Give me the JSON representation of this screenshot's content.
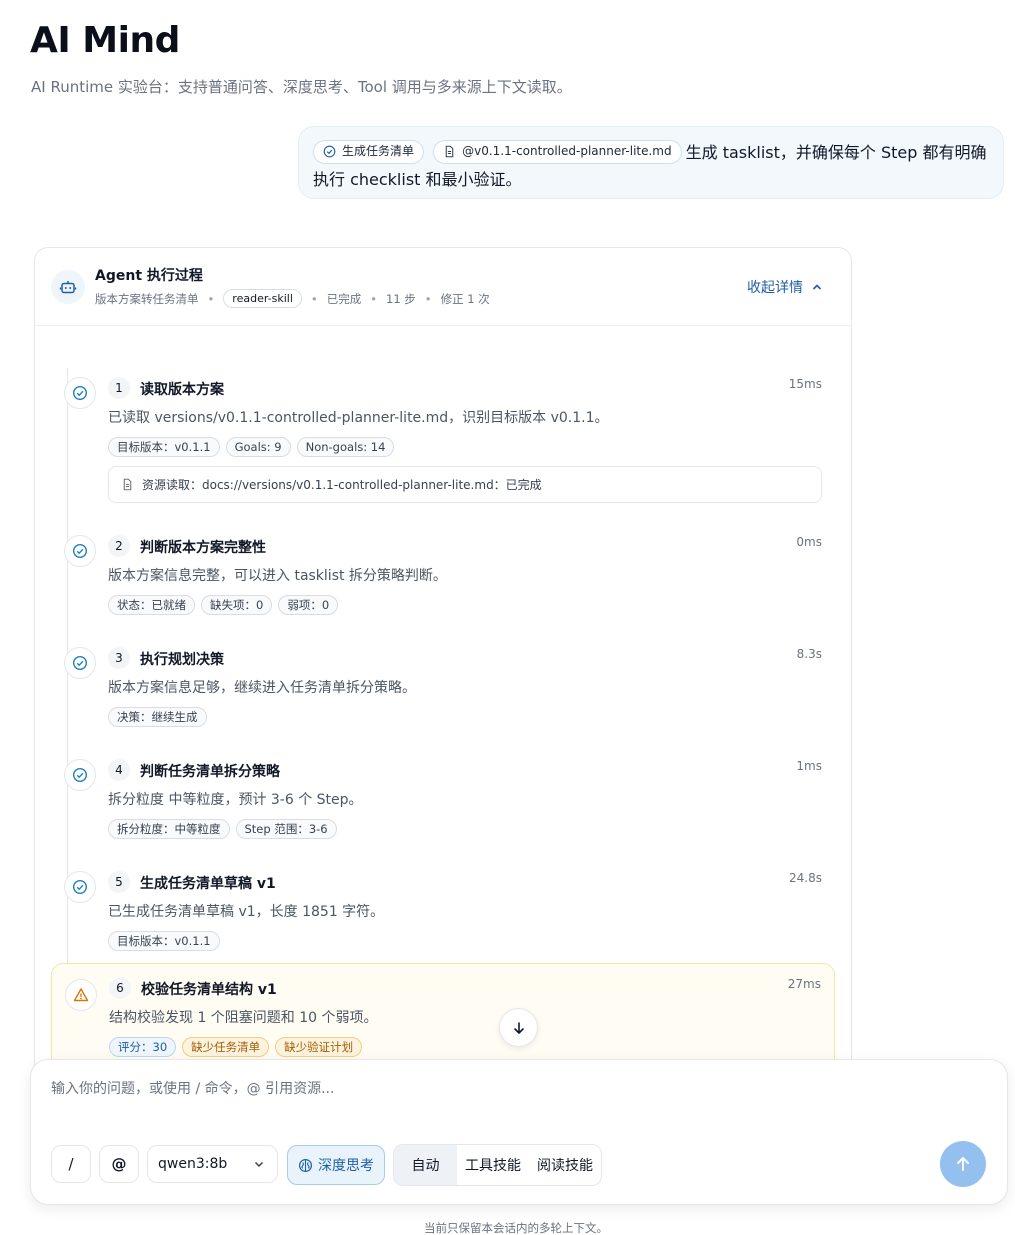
{
  "app": {
    "title": "AI Mind",
    "subtitle": "AI Runtime 实验台：支持普通问答、深度思考、Tool 调用与多来源上下文读取。"
  },
  "user_message": {
    "skill_chip": "生成任务清单",
    "file_chip": "@v0.1.1-controlled-planner-lite.md",
    "text": "生成 tasklist，并确保每个 Step 都有明确执行 checklist 和最小验证。"
  },
  "agent_panel": {
    "title": "Agent 执行过程",
    "meta": {
      "mode": "版本方案转任务清单",
      "skill": "reader-skill",
      "status": "已完成",
      "steps": "11 步",
      "revisions": "修正 1 次"
    },
    "collapse_label": "收起详情",
    "steps": [
      {
        "num": "1",
        "title": "读取版本方案",
        "time": "15ms",
        "desc": "已读取 versions/v0.1.1-controlled-planner-lite.md，识别目标版本 v0.1.1。",
        "tags": [
          "目标版本：v0.1.1",
          "Goals: 9",
          "Non-goals: 14"
        ],
        "resource": "资源读取：docs://versions/v0.1.1-controlled-planner-lite.md：已完成"
      },
      {
        "num": "2",
        "title": "判断版本方案完整性",
        "time": "0ms",
        "desc": "版本方案信息完整，可以进入 tasklist 拆分策略判断。",
        "tags": [
          "状态：已就绪",
          "缺失项：0",
          "弱项：0"
        ]
      },
      {
        "num": "3",
        "title": "执行规划决策",
        "time": "8.3s",
        "desc": "版本方案信息足够，继续进入任务清单拆分策略。",
        "tags": [
          "决策：继续生成"
        ]
      },
      {
        "num": "4",
        "title": "判断任务清单拆分策略",
        "time": "1ms",
        "desc": "拆分粒度 中等粒度，预计 3-6 个 Step。",
        "tags": [
          "拆分粒度：中等粒度",
          "Step 范围：3-6"
        ]
      },
      {
        "num": "5",
        "title": "生成任务清单草稿 v1",
        "time": "24.8s",
        "desc": "已生成任务清单草稿 v1，长度 1851 字符。",
        "tags": [
          "目标版本：v0.1.1"
        ]
      },
      {
        "num": "6",
        "title": "校验任务清单结构 v1",
        "time": "27ms",
        "desc": "结构校验发现 1 个阻塞问题和 10 个弱项。",
        "tags": [
          "评分：30",
          "缺少任务清单",
          "缺少验证计划"
        ]
      }
    ]
  },
  "composer": {
    "placeholder": "输入你的问题，或使用 / 命令，@ 引用资源...",
    "slash_label": "/",
    "at_label": "@",
    "model": "qwen3:8b",
    "deep_think_label": "深度思考",
    "modes": [
      "自动",
      "工具技能",
      "阅读技能"
    ]
  },
  "footer": "当前只保留本会话内的多轮上下文。",
  "colors": {
    "accent": "#1d5fa8",
    "success": "#1d7fc4",
    "warning": "#d97706",
    "send": "#93c0ee"
  }
}
